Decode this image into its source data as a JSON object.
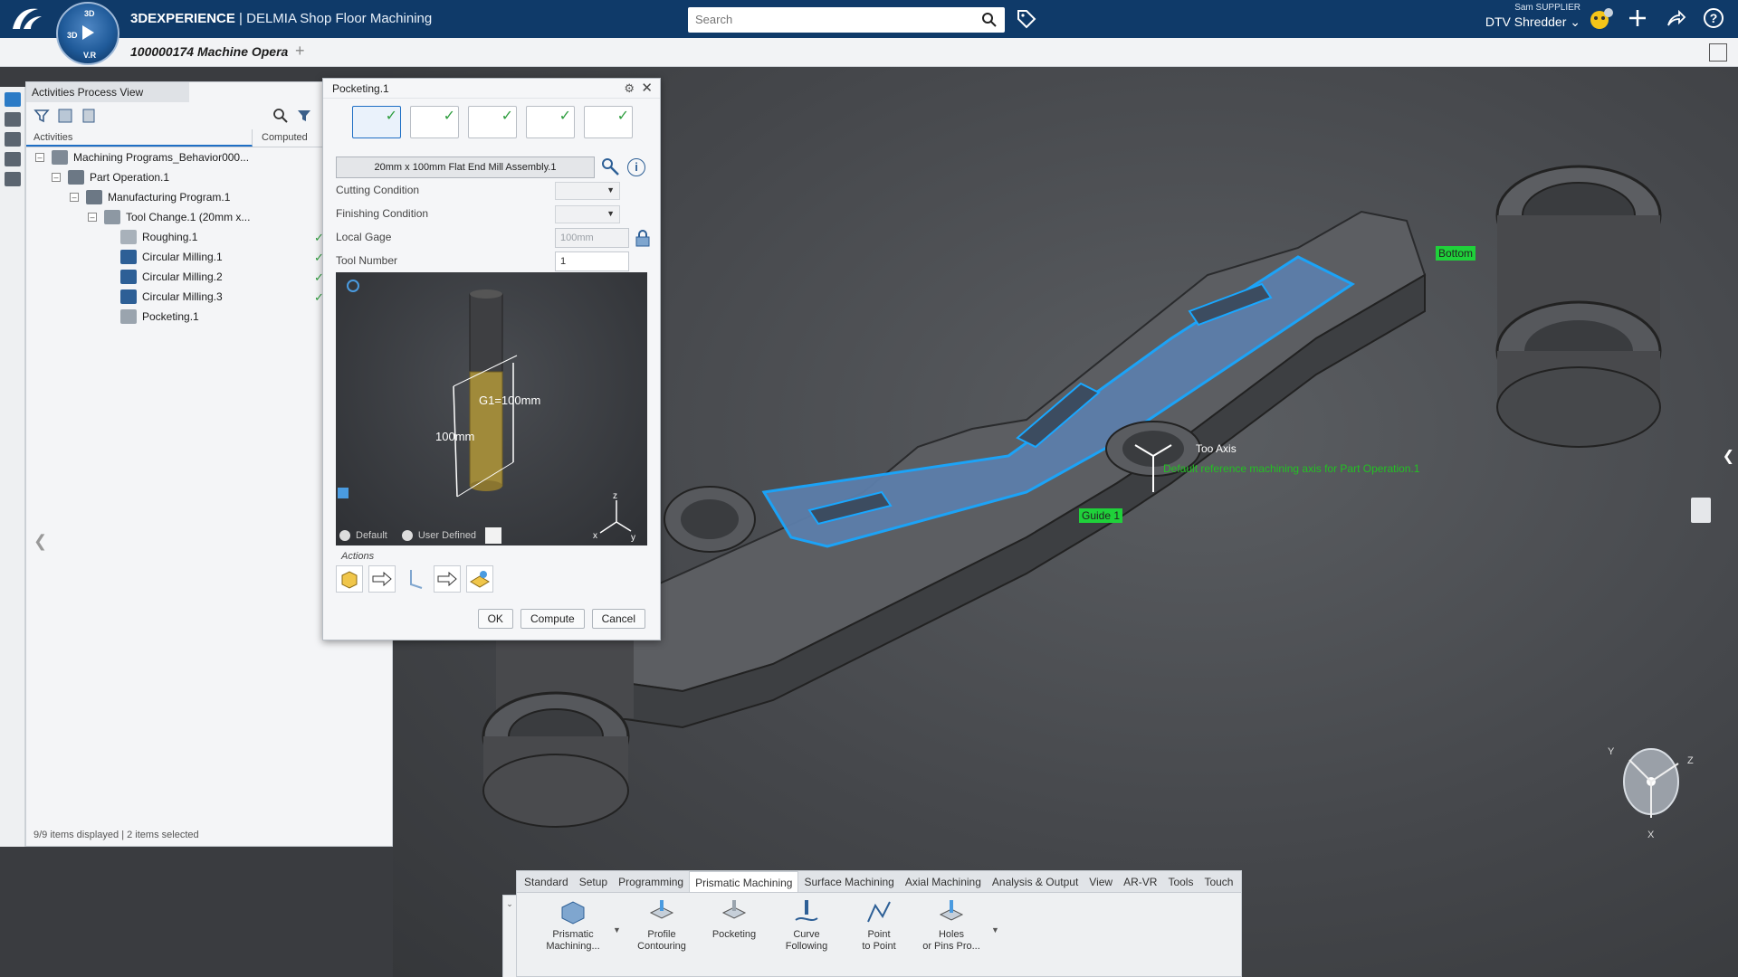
{
  "app": {
    "title_brand": "3DEXPERIENCE",
    "title_app": " | DELMIA Shop Floor Machining",
    "compass_top": "3D",
    "compass_bottom": "V.R"
  },
  "search": {
    "placeholder": "Search"
  },
  "user": {
    "name": "Sam SUPPLIER",
    "context": "DTV Shredder"
  },
  "doc_tab": {
    "label": "100000174 Machine Opera"
  },
  "left_panel": {
    "title": "Activities Process View",
    "col_activities": "Activities",
    "col_computed": "Computed",
    "status": "9/9 items displayed | 2 items selected",
    "tree": [
      {
        "label": "Machining Programs_Behavior000...",
        "checked": false
      },
      {
        "label": "Part Operation.1",
        "checked": false
      },
      {
        "label": "Manufacturing Program.1",
        "checked": false
      },
      {
        "label": "Tool Change.1 (20mm x...",
        "checked": false
      },
      {
        "label": "Roughing.1",
        "checked": true
      },
      {
        "label": "Circular Milling.1",
        "checked": true
      },
      {
        "label": "Circular Milling.2",
        "checked": true
      },
      {
        "label": "Circular Milling.3",
        "checked": true
      },
      {
        "label": "Pocketing.1",
        "checked": false
      }
    ]
  },
  "dialog": {
    "title": "Pocketing.1",
    "tool_name": "20mm x 100mm Flat End Mill Assembly.1",
    "cutting_condition_label": "Cutting Condition",
    "finishing_condition_label": "Finishing Condition",
    "local_gage_label": "Local Gage",
    "local_gage_value": "100mm",
    "tool_number_label": "Tool Number",
    "tool_number_value": "1",
    "preview_dim1": "G1=100mm",
    "preview_dim2": "100mm",
    "radio_default": "Default",
    "radio_user": "User Defined",
    "actions_label": "Actions",
    "ok": "OK",
    "compute": "Compute",
    "cancel": "Cancel"
  },
  "viewport": {
    "label_bottom": "Bottom",
    "label_guide": "Guide 1",
    "label_tool_axis": "Too  Axis",
    "label_axis_note": "Default reference machining axis for Part Operation.1"
  },
  "action_bar": {
    "tabs": [
      "Standard",
      "Setup",
      "Programming",
      "Prismatic Machining",
      "Surface Machining",
      "Axial Machining",
      "Analysis & Output",
      "View",
      "AR-VR",
      "Tools",
      "Touch"
    ],
    "active_tab": "Prismatic Machining",
    "commands": [
      {
        "line1": "Prismatic",
        "line2": "Machining..."
      },
      {
        "line1": "Profile",
        "line2": "Contouring"
      },
      {
        "line1": "Pocketing",
        "line2": ""
      },
      {
        "line1": "Curve",
        "line2": "Following"
      },
      {
        "line1": "Point",
        "line2": "to Point"
      },
      {
        "line1": "Holes",
        "line2": "or Pins Pro..."
      }
    ]
  },
  "colors": {
    "header_bg": "#0f3a69",
    "accent": "#1f6fc5",
    "check_green": "#2f9e3f",
    "label_green": "#23c023"
  }
}
